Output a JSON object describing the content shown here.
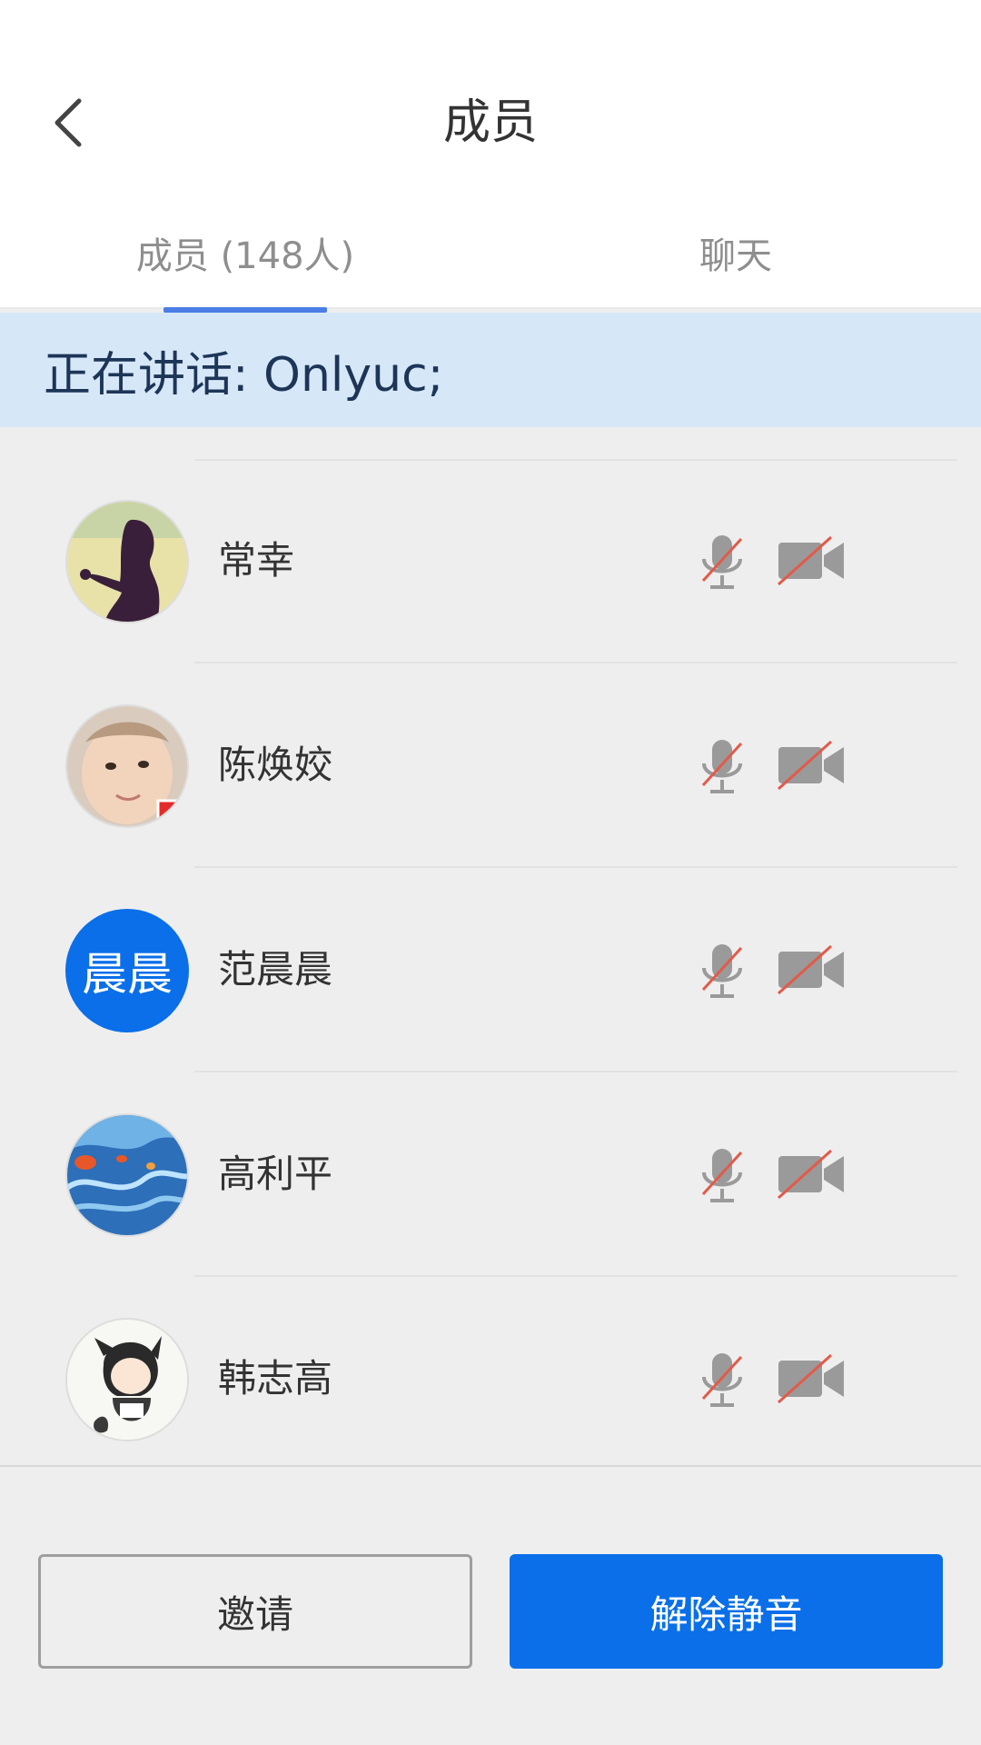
{
  "header": {
    "title": "成员",
    "tabs": [
      {
        "label": "成员 (148人)",
        "active": true
      },
      {
        "label": "聊天",
        "active": false
      }
    ]
  },
  "speaking": {
    "text": "正在讲话: Onlyuc;"
  },
  "members": [
    {
      "name": "常幸",
      "avatar": "photo-silhouette",
      "mic_muted": true,
      "camera_off": true
    },
    {
      "name": "陈焕姣",
      "avatar": "photo-baby",
      "mic_muted": true,
      "camera_off": true
    },
    {
      "name": "范晨晨",
      "avatar_text": "晨晨",
      "avatar_color": "#0a6fe8",
      "mic_muted": true,
      "camera_off": true
    },
    {
      "name": "高利平",
      "avatar": "photo-blue-waves",
      "mic_muted": true,
      "camera_off": true
    },
    {
      "name": "韩志高",
      "avatar": "photo-anime-boy",
      "mic_muted": true,
      "camera_off": true
    }
  ],
  "actions": {
    "invite_label": "邀请",
    "unmute_label": "解除静音"
  },
  "colors": {
    "accent": "#0a6fe8",
    "tab_underline": "#4a7ee6",
    "banner_bg": "#d6e7f8",
    "muted_slash": "#e25a4a"
  }
}
